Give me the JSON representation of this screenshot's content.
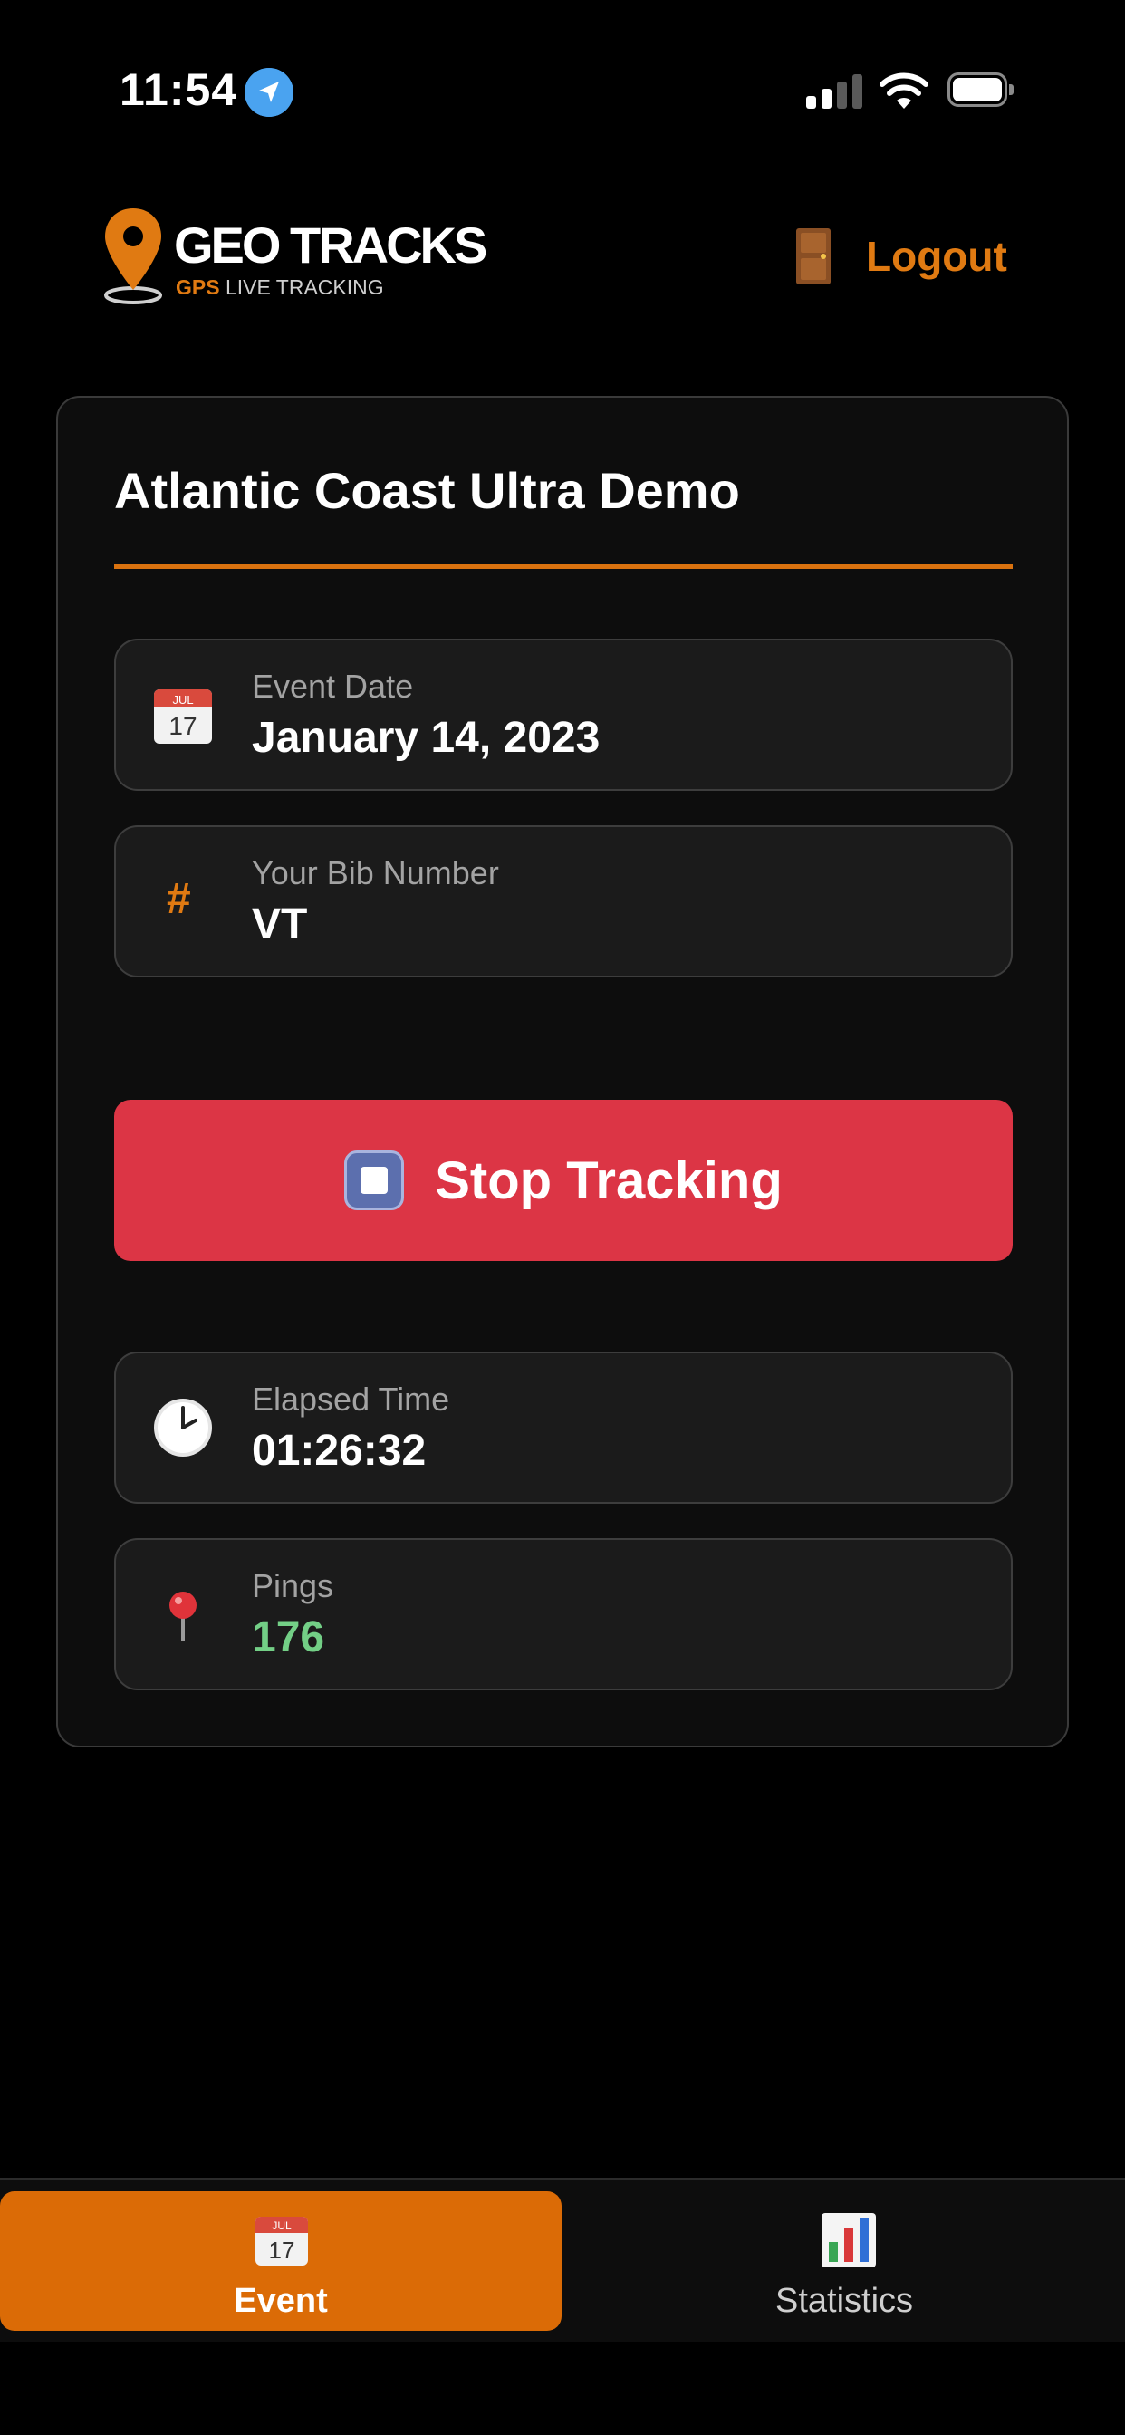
{
  "status_bar": {
    "time": "11:54"
  },
  "header": {
    "logo": {
      "title": "GEO TRACKS",
      "subtitle_gps": "GPS",
      "subtitle_rest": " LIVE TRACKING"
    },
    "logout_label": "Logout"
  },
  "card": {
    "event_title": "Atlantic Coast Ultra Demo",
    "event_date": {
      "label": "Event Date",
      "value": "January 14, 2023",
      "icon_month": "JUL",
      "icon_day": "17"
    },
    "bib": {
      "label": "Your Bib Number",
      "value": "VT",
      "icon_glyph": "#"
    },
    "stop_button_label": "Stop Tracking",
    "elapsed": {
      "label": "Elapsed Time",
      "value": "01:26:32"
    },
    "pings": {
      "label": "Pings",
      "value": "176"
    }
  },
  "tabs": [
    {
      "label": "Event",
      "icon": "calendar-icon",
      "active": true
    },
    {
      "label": "Statistics",
      "icon": "bar-chart-icon",
      "active": false
    }
  ],
  "colors": {
    "accent": "#e07a12",
    "stop_button": "#dc3545",
    "pings_value": "#73cf86",
    "active_tab": "#db6b06"
  }
}
